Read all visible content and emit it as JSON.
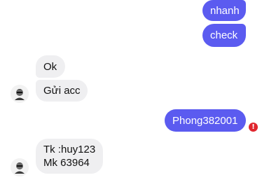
{
  "messages": {
    "out_1": "nhanh",
    "out_2": "check",
    "in_1": "Ok",
    "in_2": "Gửi acc",
    "out_3": "Phong382001",
    "in_3_line1": "Tk :huy123",
    "in_3_line2": "Mk 63964"
  },
  "colors": {
    "outgoing_bubble": "#5b5bf0",
    "incoming_bubble": "#efeff1",
    "error_badge": "#e0262e"
  },
  "icons": {
    "error": "exclamation-icon",
    "avatar": "contact-avatar"
  }
}
